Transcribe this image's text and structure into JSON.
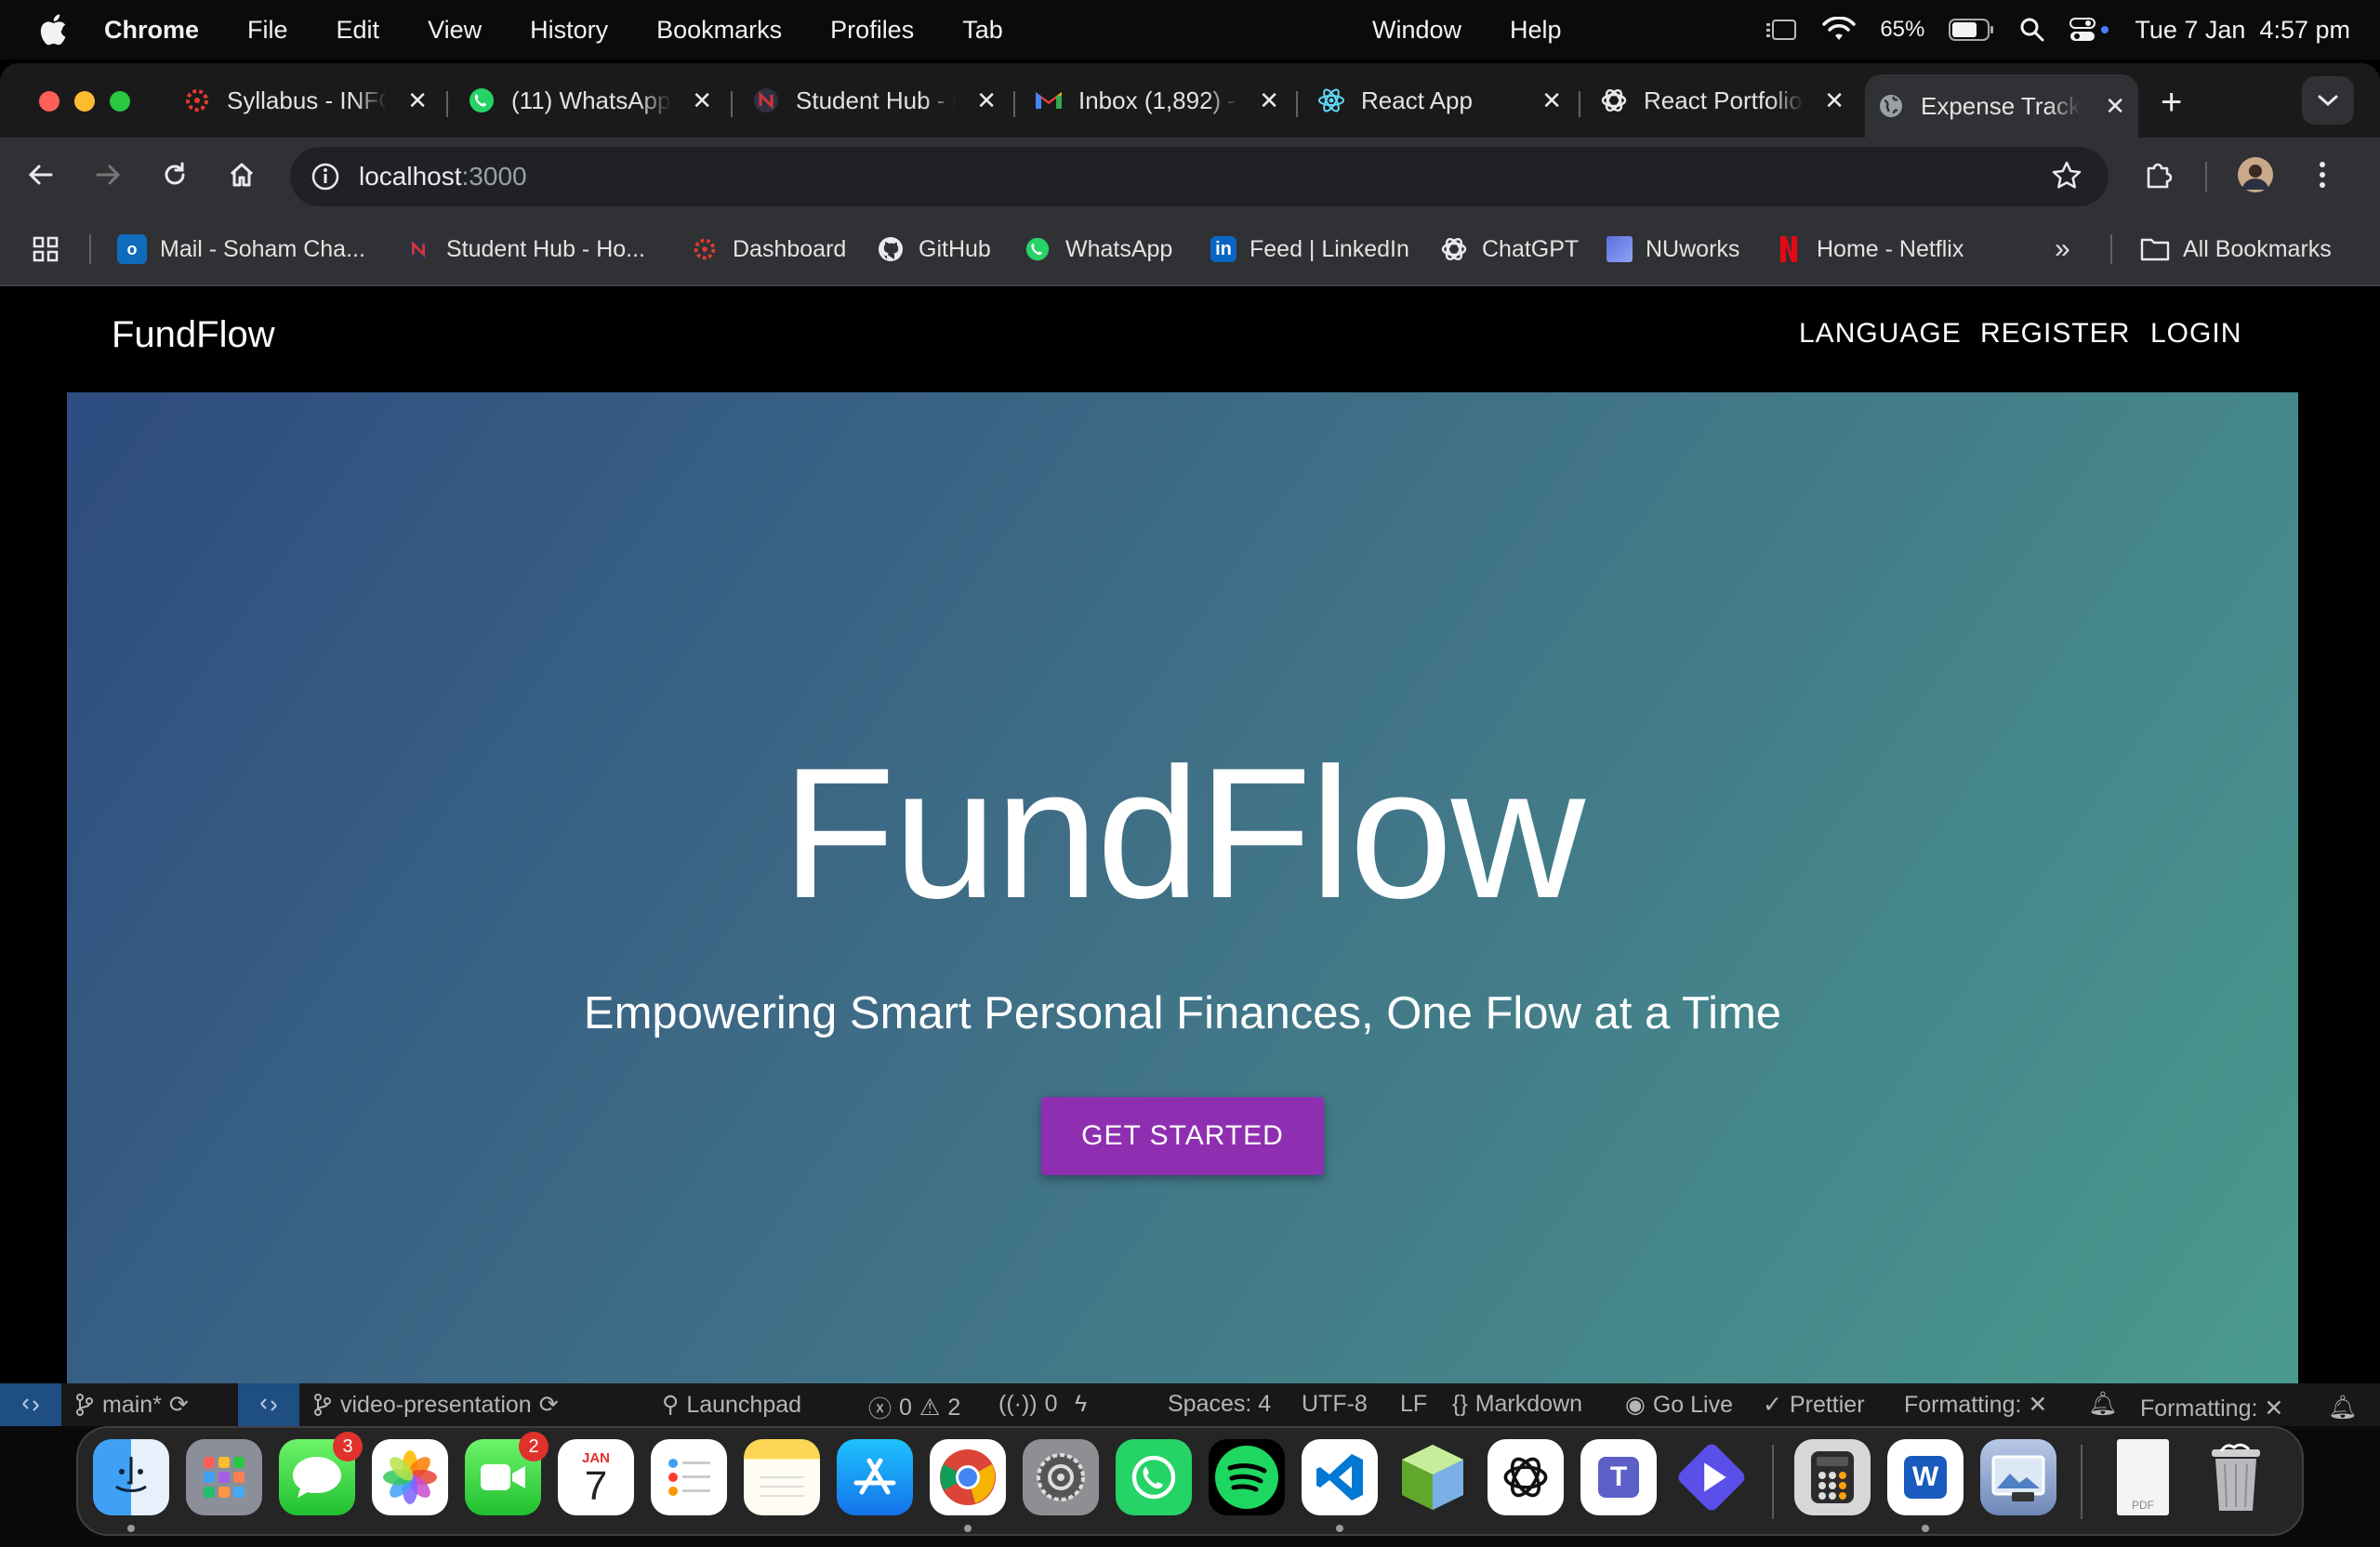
{
  "menubar": {
    "app": "Chrome",
    "items": [
      "File",
      "Edit",
      "View",
      "History",
      "Bookmarks",
      "Profiles",
      "Tab"
    ],
    "items_mid": [
      "Window",
      "Help"
    ],
    "battery": "65%",
    "datetime": "Tue 7 Jan  4:57 pm"
  },
  "tabs": [
    {
      "title": "Syllabus - INFO",
      "icon": "canvas-icon"
    },
    {
      "title": "(11) WhatsApp",
      "icon": "whatsapp-icon"
    },
    {
      "title": "Student Hub - N",
      "icon": "student-hub-icon"
    },
    {
      "title": "Inbox (1,892) -",
      "icon": "gmail-icon"
    },
    {
      "title": "React App",
      "icon": "react-icon"
    },
    {
      "title": "React Portfolio",
      "icon": "chatgpt-icon"
    },
    {
      "title": "Expense Tracker",
      "icon": "globe-icon",
      "active": true
    }
  ],
  "address": {
    "host": "localhost",
    "port": ":3000"
  },
  "bookmarks": [
    {
      "label": "Mail - Soham Cha...",
      "icon": "outlook-icon"
    },
    {
      "label": "Student Hub - Ho...",
      "icon": "student-hub-icon"
    },
    {
      "label": "Dashboard",
      "icon": "canvas-icon"
    },
    {
      "label": "GitHub",
      "icon": "github-icon"
    },
    {
      "label": "WhatsApp",
      "icon": "whatsapp-icon"
    },
    {
      "label": "Feed | LinkedIn",
      "icon": "linkedin-icon"
    },
    {
      "label": "ChatGPT",
      "icon": "chatgpt-icon"
    },
    {
      "label": "NUworks",
      "icon": "nuworks-icon"
    },
    {
      "label": "Home - Netflix",
      "icon": "netflix-icon"
    }
  ],
  "bookmarks_all": "All Bookmarks",
  "app": {
    "brand": "FundFlow",
    "nav": [
      "LANGUAGE",
      "REGISTER",
      "LOGIN"
    ],
    "hero_title": "FundFlow",
    "hero_subtitle": "Empowering Smart Personal Finances, One Flow at a Time",
    "cta": "GET STARTED",
    "colors": {
      "cta": "#8e2fb1",
      "hero_start": "#2e4c80",
      "hero_end": "#4a9a8e"
    }
  },
  "vscode_status": {
    "branch": "main*",
    "branch2": "video-presentation",
    "launchpad": "Launchpad",
    "errors": "0",
    "warnings": "2",
    "ports": "0",
    "spaces": "Spaces: 4",
    "encoding": "UTF-8",
    "eol": "LF",
    "language": "Markdown",
    "golive": "Go Live",
    "prettier": "Prettier",
    "formatting": "Formatting: ✕",
    "formatting2": "Formatting: ✕"
  },
  "dock": {
    "calendar_month": "JAN",
    "calendar_day": "7",
    "messages_badge": "3",
    "facetime_badge": "2",
    "word_letter": "W",
    "teams_letter": "T",
    "pdf_label": "PDF"
  }
}
